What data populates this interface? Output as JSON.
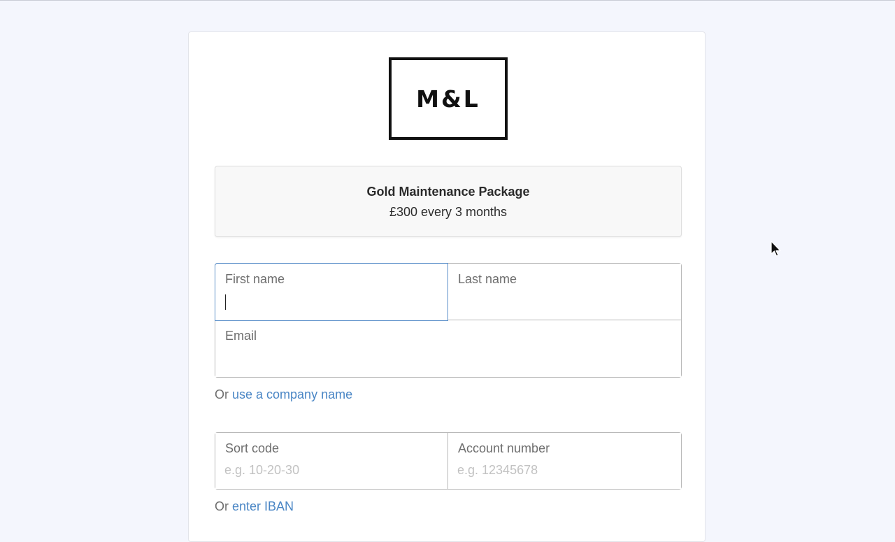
{
  "logo": {
    "text": "M&L"
  },
  "package": {
    "name": "Gold Maintenance Package",
    "price": "£300 every 3 months"
  },
  "fields": {
    "first_name": {
      "label": "First name",
      "value": "",
      "placeholder": "",
      "focused": true
    },
    "last_name": {
      "label": "Last name",
      "value": "",
      "placeholder": ""
    },
    "email": {
      "label": "Email",
      "value": "",
      "placeholder": ""
    },
    "sort_code": {
      "label": "Sort code",
      "value": "",
      "placeholder": "e.g. 10-20-30"
    },
    "account_number": {
      "label": "Account number",
      "value": "",
      "placeholder": "e.g. 12345678"
    }
  },
  "links": {
    "company_prefix": "Or ",
    "company_link": "use a company name",
    "iban_prefix": "Or ",
    "iban_link": "enter IBAN"
  },
  "colors": {
    "background": "#f4f6fd",
    "link": "#4a86c5",
    "focus_border": "#5b8fc9",
    "field_border": "#b8b8b8"
  },
  "icons": {
    "mouse_cursor": "arrow-pointer-icon"
  }
}
